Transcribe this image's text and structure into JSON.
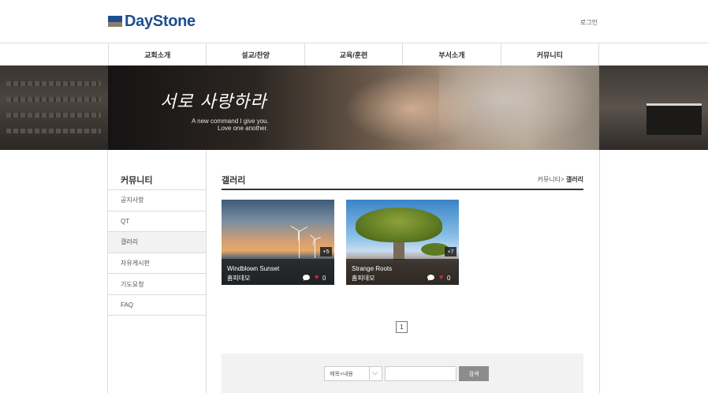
{
  "header": {
    "logo_text": "DayStone",
    "login_label": "로그인"
  },
  "nav": {
    "items": [
      "교회소개",
      "설교/찬양",
      "교육/훈련",
      "부서소개",
      "커뮤니티"
    ]
  },
  "banner": {
    "title": "서로 사랑하라",
    "subtitle_line1": "A new command I give you.",
    "subtitle_line2": "Love one another."
  },
  "sidebar": {
    "title": "커뮤니티",
    "items": [
      "공지사항",
      "QT",
      "갤러리",
      "자유게시판",
      "기도요청",
      "FAQ"
    ],
    "active_index": 2
  },
  "content": {
    "title": "갤러리",
    "breadcrumb_parent": "커뮤니티>",
    "breadcrumb_current": "갤러리"
  },
  "gallery": [
    {
      "title": "Windblown Sunset",
      "author": "홈피데모",
      "photo_count": "+5",
      "likes": "0"
    },
    {
      "title": "Strange Roots",
      "author": "홈피데모",
      "photo_count": "+7",
      "likes": "0"
    }
  ],
  "pagination": {
    "current": "1"
  },
  "search": {
    "select_value": "제목+내용",
    "input_value": "",
    "button_label": "검색"
  },
  "colors": {
    "brand": "#1d4f8f",
    "like": "#d8283a",
    "button": "#8c8c8c"
  }
}
